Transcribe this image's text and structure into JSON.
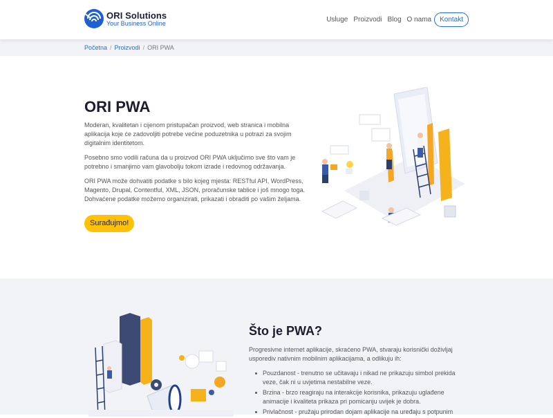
{
  "brand": {
    "name": "ORI Solutions",
    "tagline": "Your Business Online"
  },
  "nav": {
    "items": [
      "Usluge",
      "Proizvodi",
      "Blog",
      "O nama"
    ],
    "contact": "Kontakt"
  },
  "breadcrumb": {
    "home": "Početna",
    "section": "Proizvodi",
    "current": "ORI PWA",
    "separator": "/"
  },
  "hero": {
    "title": "ORI PWA",
    "p1": "Moderan, kvalitetan i cijenom pristupačan proizvod, web stranica i mobilna aplikacija koje će zadovoljiti potrebe većine poduzetnika u potrazi za svojim digitalnim identitetom.",
    "p2": "Posebno smo vodili računa da u proizvod ORI PWA uključimo sve što vam je potrebno i smanjimo vam glavobolju tokom izrade i redovnog održavanja.",
    "p3": "ORI PWA može dohvatiti podatke s bilo kojeg mjesta: RESTful API, WordPress, Magento, Drupal, Contentful, XML, JSON, proračunske tablice i još mnogo toga. Dohvaćene podatke možemo organizirati, prikazati i obraditi po vašim željama.",
    "cta": "Surađujmo!"
  },
  "pwa": {
    "title": "Što je PWA?",
    "intro": "Progresivne internet aplikacije, skraćeno PWA, stvaraju korisnički doživljaj usporediv nativnim mobilnim aplikacijama, a odlikuju ih:",
    "bullets": [
      "Pouzdanost - trenutno se učitavaju i nikad ne prikazuju simbol prekida veze, čak ni u uvjetima nestabilne veze.",
      "Brzina - brzo reagiraju na interakcije korisnika, prikazuju uglađene animacije i kvaliteta prikaza pri pomicanju uvijek je dobra.",
      "Privlačnost - pružaju prirodan dojam aplikacije na uređaju s potpunim"
    ]
  },
  "colors": {
    "primary": "#1f6fe0",
    "accent": "#ffc107",
    "section_bg": "#f1f3f7",
    "dark": "#1c1c2c"
  },
  "icons": {
    "logo": "ori-logo-icon"
  }
}
